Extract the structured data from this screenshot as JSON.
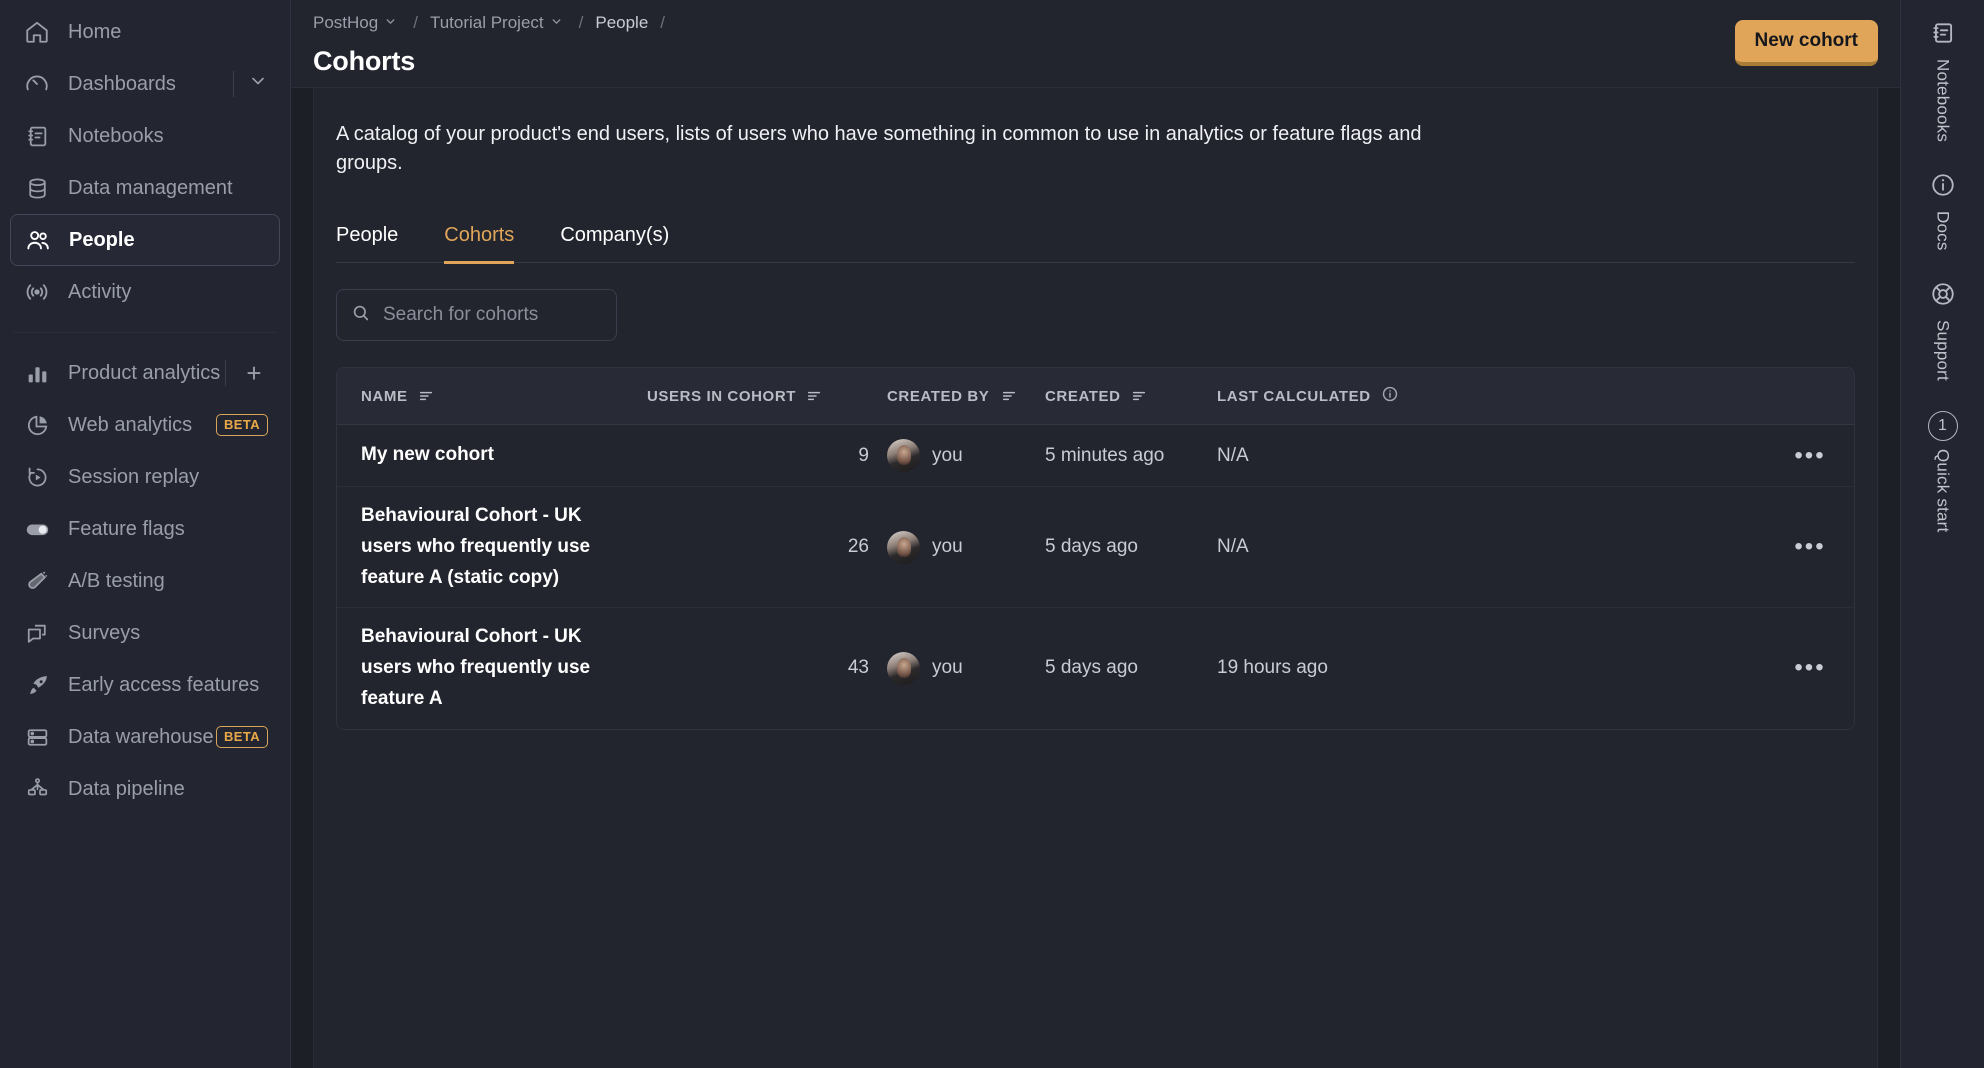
{
  "sidebar": {
    "primary": [
      {
        "label": "Home",
        "icon": "home-icon"
      },
      {
        "label": "Dashboards",
        "icon": "gauge-icon",
        "has_chevron": true
      },
      {
        "label": "Notebooks",
        "icon": "notebook-icon"
      },
      {
        "label": "Data management",
        "icon": "database-icon"
      },
      {
        "label": "People",
        "icon": "people-icon",
        "active": true
      },
      {
        "label": "Activity",
        "icon": "broadcast-icon"
      }
    ],
    "products": [
      {
        "label": "Product analytics",
        "icon": "bar-chart-icon",
        "action": "+"
      },
      {
        "label": "Web analytics",
        "icon": "pie-chart-icon",
        "badge": "BETA"
      },
      {
        "label": "Session replay",
        "icon": "replay-icon"
      },
      {
        "label": "Feature flags",
        "icon": "toggle-icon"
      },
      {
        "label": "A/B testing",
        "icon": "flask-icon"
      },
      {
        "label": "Surveys",
        "icon": "chat-icon"
      },
      {
        "label": "Early access features",
        "icon": "rocket-icon"
      },
      {
        "label": "Data warehouse",
        "icon": "server-icon",
        "badge": "BETA"
      },
      {
        "label": "Data pipeline",
        "icon": "pipeline-icon"
      }
    ]
  },
  "topbar": {
    "breadcrumbs": [
      {
        "label": "PostHog",
        "chevron": true
      },
      {
        "label": "Tutorial Project",
        "chevron": true
      },
      {
        "label": "People",
        "chevron": false
      }
    ],
    "title": "Cohorts",
    "new_button": "New cohort"
  },
  "main": {
    "description": "A catalog of your product's end users, lists of users who have something in common to use in analytics or feature flags and groups.",
    "tabs": [
      {
        "label": "People",
        "active": false
      },
      {
        "label": "Cohorts",
        "active": true
      },
      {
        "label": "Company(s)",
        "active": false
      }
    ],
    "search": {
      "placeholder": "Search for cohorts",
      "value": ""
    },
    "table": {
      "columns": [
        {
          "key": "name",
          "label": "NAME",
          "sortable": true
        },
        {
          "key": "users",
          "label": "USERS IN COHORT",
          "sortable": true
        },
        {
          "key": "created_by",
          "label": "CREATED BY",
          "sortable": true
        },
        {
          "key": "created",
          "label": "CREATED",
          "sortable": true
        },
        {
          "key": "last_calculated",
          "label": "LAST CALCULATED",
          "info": true
        }
      ],
      "rows": [
        {
          "name": "My new cohort",
          "users": "9",
          "created_by": "you",
          "created": "5 minutes ago",
          "last_calculated": "N/A",
          "menu": "•••"
        },
        {
          "name": "Behavioural Cohort - UK users who frequently use feature A (static copy)",
          "users": "26",
          "created_by": "you",
          "created": "5 days ago",
          "last_calculated": "N/A",
          "menu": "•••"
        },
        {
          "name": "Behavioural Cohort - UK users who frequently use feature A",
          "users": "43",
          "created_by": "you",
          "created": "5 days ago",
          "last_calculated": "19 hours ago",
          "menu": "•••"
        }
      ]
    }
  },
  "right_rail": [
    {
      "label": "Notebooks",
      "icon": "notebook-icon"
    },
    {
      "label": "Docs",
      "icon": "info-circle-icon"
    },
    {
      "label": "Support",
      "icon": "lifebuoy-icon"
    },
    {
      "label": "Quick start",
      "icon": "count-badge",
      "count": "1"
    }
  ],
  "colors": {
    "accent": "#e0a558",
    "page_bg": "#1d1f27",
    "panel_bg": "#22242e",
    "sidebar_bg": "#232630"
  }
}
